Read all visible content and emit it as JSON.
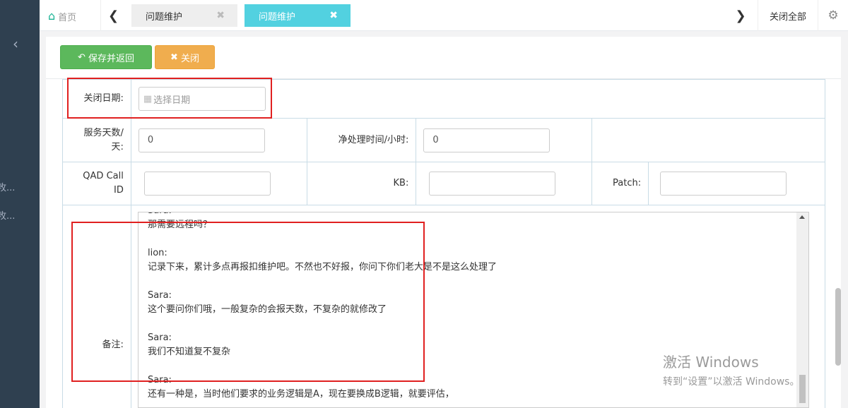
{
  "sidebar": {
    "collapse_icon": "chevron-left-icon",
    "items": [
      {
        "label": "敉..."
      },
      {
        "label": "敉..."
      }
    ]
  },
  "tabs": {
    "home": {
      "icon": "home-icon",
      "label": "首页"
    },
    "prev_icon": "chevron-left-icon",
    "next_icon": "chevron-right-icon",
    "items": [
      {
        "label": "问题维护",
        "active": false
      },
      {
        "label": "问题维护",
        "active": true
      }
    ],
    "close_glyph": "✖",
    "close_all_label": "关闭全部",
    "settings_icon": "gear-icon"
  },
  "toolbar": {
    "save_label": "保存并返回",
    "close_label": "关闭",
    "save_color": "#5cb85c",
    "close_color": "#f0ad4e"
  },
  "form": {
    "close_date_label": "关闭日期:",
    "close_date_placeholder": "选择日期",
    "service_days_label_1": "服务天数/",
    "service_days_label_2": "天:",
    "service_days_value": "0",
    "net_hours_label": "净处理时间/小时:",
    "net_hours_value": "0",
    "qad_label_1": "QAD Call",
    "qad_label_2": "ID",
    "qad_value": "",
    "kb_label": "KB:",
    "kb_value": "",
    "patch_label": "Patch:",
    "patch_value": "",
    "remarks_label": "备注:",
    "remarks_lines": [
      "Sara:",
      "那需要远程吗？",
      "",
      "lion:",
      "记录下来，累计多点再报扣维护吧。不然也不好报，你问下你们老大是不是这么处理了",
      "",
      "Sara:",
      "这个要问你们哦，一般复杂的会报天数，不复杂的就修改了",
      "",
      "Sara:",
      "我们不知道复不复杂",
      "",
      "Sara:",
      "还有一种是，当时他们要求的业务逻辑是A，现在要换成B逻辑，就要评估，"
    ]
  },
  "watermark": {
    "line1": "激活 Windows",
    "line2": "转到“设置”以激活 Windows。"
  },
  "colors": {
    "sidebar": "#2f4050",
    "active_tab": "#52d1e0",
    "highlight": "#e02020"
  }
}
